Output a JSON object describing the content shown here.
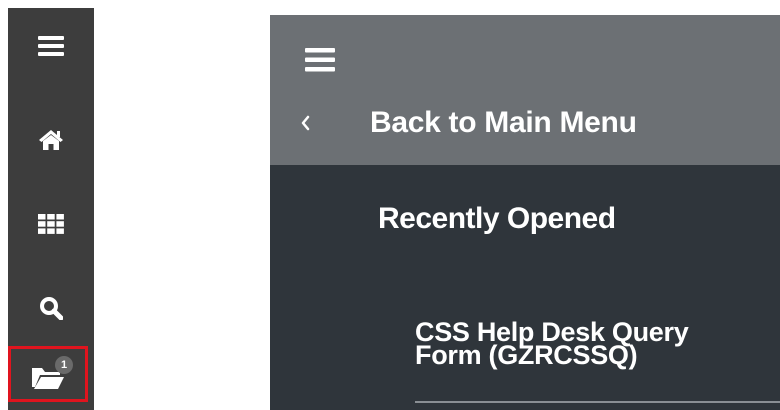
{
  "rail": {
    "icons": [
      "hamburger-menu-icon",
      "home-icon",
      "grid-apps-icon",
      "search-icon",
      "folder-open-icon"
    ],
    "recent_badge": "1"
  },
  "panel": {
    "back_label": "Back to Main Menu",
    "section_title": "Recently Opened",
    "recent_items": [
      {
        "line1": "CSS Help Desk Query",
        "line2": "Form (GZRCSSQ)"
      }
    ]
  },
  "colors": {
    "rail_bg": "#3d3d3d",
    "panel_header_bg": "#6c7074",
    "panel_body_bg": "#2f353b",
    "highlight_border": "#e0141e",
    "text": "#ffffff"
  }
}
